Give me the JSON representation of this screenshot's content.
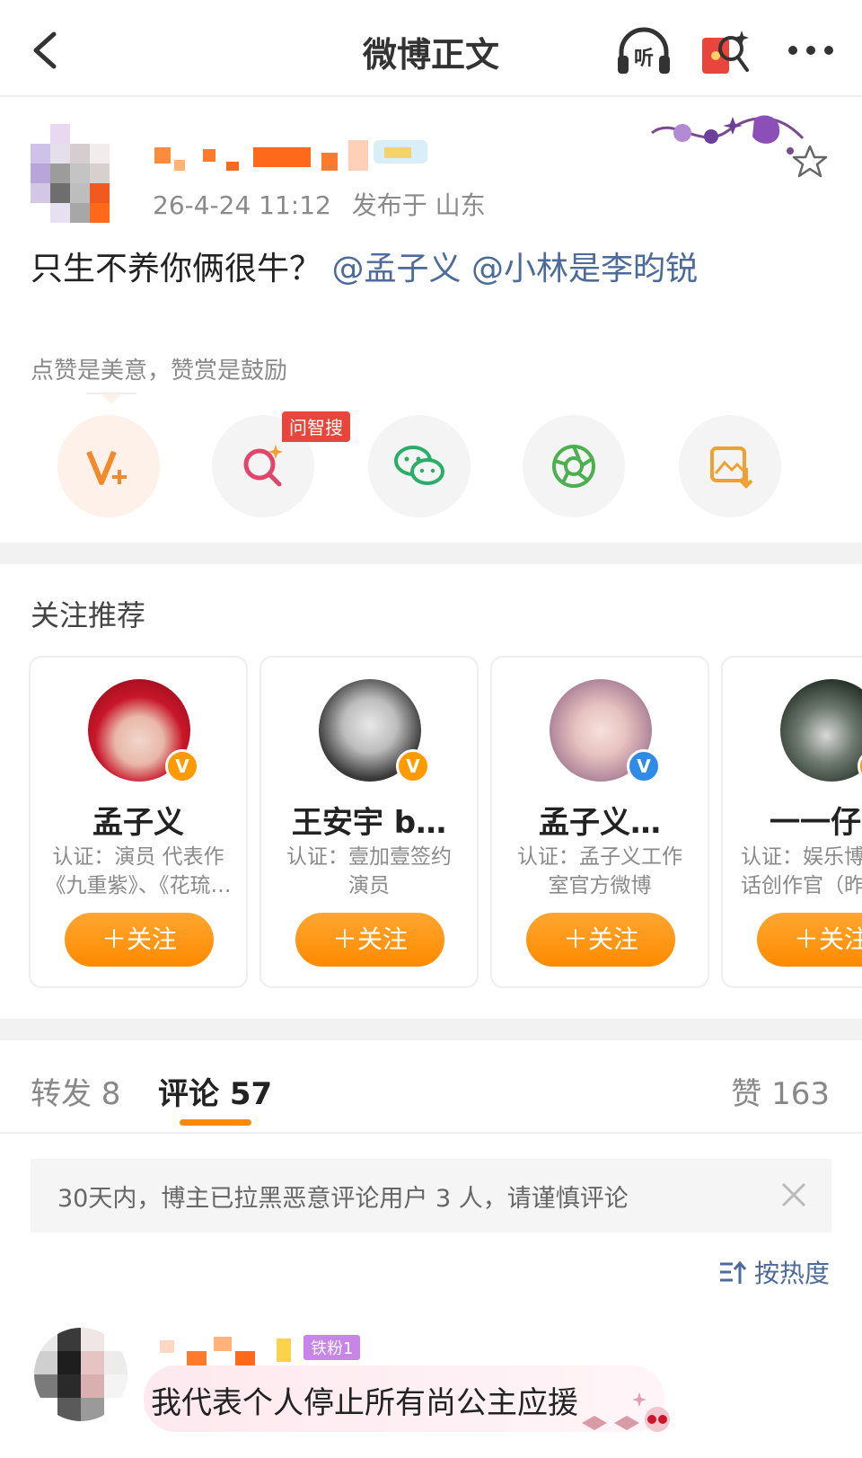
{
  "header": {
    "title": "微博正文",
    "listen_label": "听"
  },
  "post": {
    "timestamp": "26-4-24 11:12",
    "location": "发布于 山东",
    "text_main": "只生不养你俩很牛？",
    "mention_1": "@孟子义",
    "mention_2": "@小林是李昀锐",
    "reward_hint": "点赞是美意，赞赏是鼓励",
    "badge_label": "问智搜"
  },
  "share_actions": [
    {
      "icon": "v-plus-icon"
    },
    {
      "icon": "ai-search-icon"
    },
    {
      "icon": "wechat-icon"
    },
    {
      "icon": "moments-icon"
    },
    {
      "icon": "save-image-icon"
    }
  ],
  "recommend": {
    "title": "关注推荐",
    "follow_label": "＋关注",
    "cards": [
      {
        "name": "孟子义",
        "desc": "认证：演员 代表作\n《九重紫》、《花琉…",
        "badge": "orange"
      },
      {
        "name": "王安宇 b…",
        "desc": "认证：壹加壹签约\n演员",
        "badge": "orange"
      },
      {
        "name": "孟子义…",
        "desc": "认证：孟子义工作\n室官方微博",
        "badge": "blue"
      },
      {
        "name": "一一仔",
        "desc": "认证：娱乐博\n话创作官（昨",
        "badge": "orange"
      }
    ]
  },
  "tabs": {
    "repost": "转发 8",
    "comment": "评论 57",
    "like": "赞 163"
  },
  "notice": {
    "text": "30天内，博主已拉黑恶意评论用户 3 人，请谨慎评论"
  },
  "sort": {
    "label": "按热度"
  },
  "comment": {
    "fan_badge": "铁粉1",
    "text": "我代表个人停止所有尚公主应援"
  },
  "colors": {
    "accent": "#ff8a00",
    "link": "#4c6b9a",
    "badge_red": "#e8453c"
  }
}
